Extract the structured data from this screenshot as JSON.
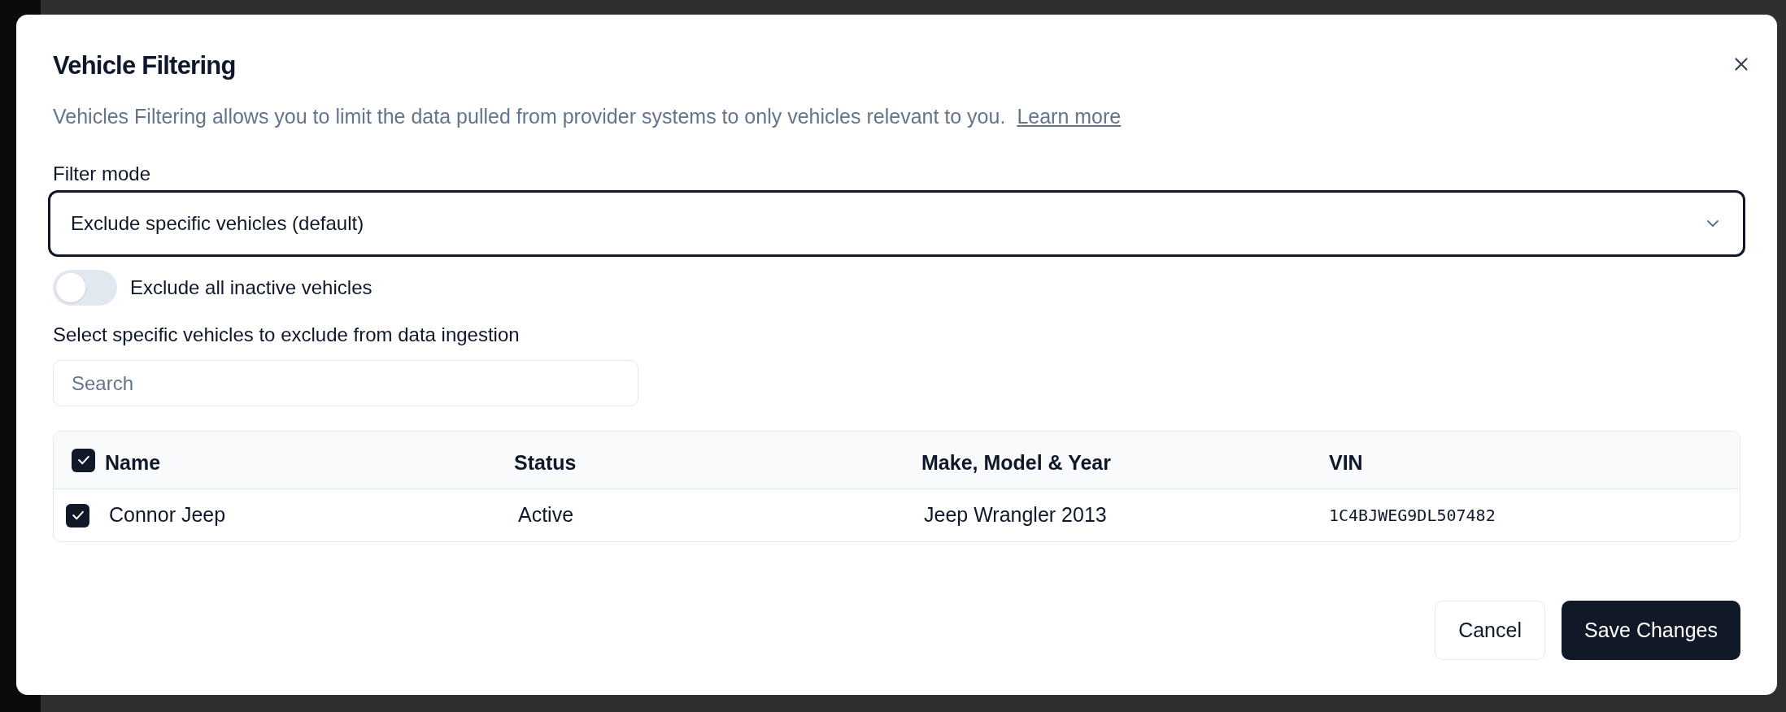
{
  "dialog": {
    "title": "Vehicle Filtering",
    "description": "Vehicles Filtering allows you to limit the data pulled from provider systems to only vehicles relevant to you.",
    "learn_more_link": "Learn more"
  },
  "filter_mode": {
    "label": "Filter mode",
    "value": "Exclude specific vehicles (default)"
  },
  "inactive_toggle": {
    "label": "Exclude all inactive vehicles",
    "on": false
  },
  "selection": {
    "label": "Select specific vehicles to exclude from data ingestion",
    "search": {
      "placeholder": "Search"
    }
  },
  "table": {
    "select_all_checked": true,
    "columns": [
      "Name",
      "Status",
      "Make, Model & Year",
      "VIN"
    ],
    "rows": [
      {
        "checked": true,
        "name": "Connor Jeep",
        "status": "Active",
        "make_model_year": "Jeep Wrangler 2013",
        "vin": "1C4BJWEG9DL507482"
      }
    ]
  },
  "buttons": {
    "cancel": "Cancel",
    "save": "Save Changes"
  }
}
